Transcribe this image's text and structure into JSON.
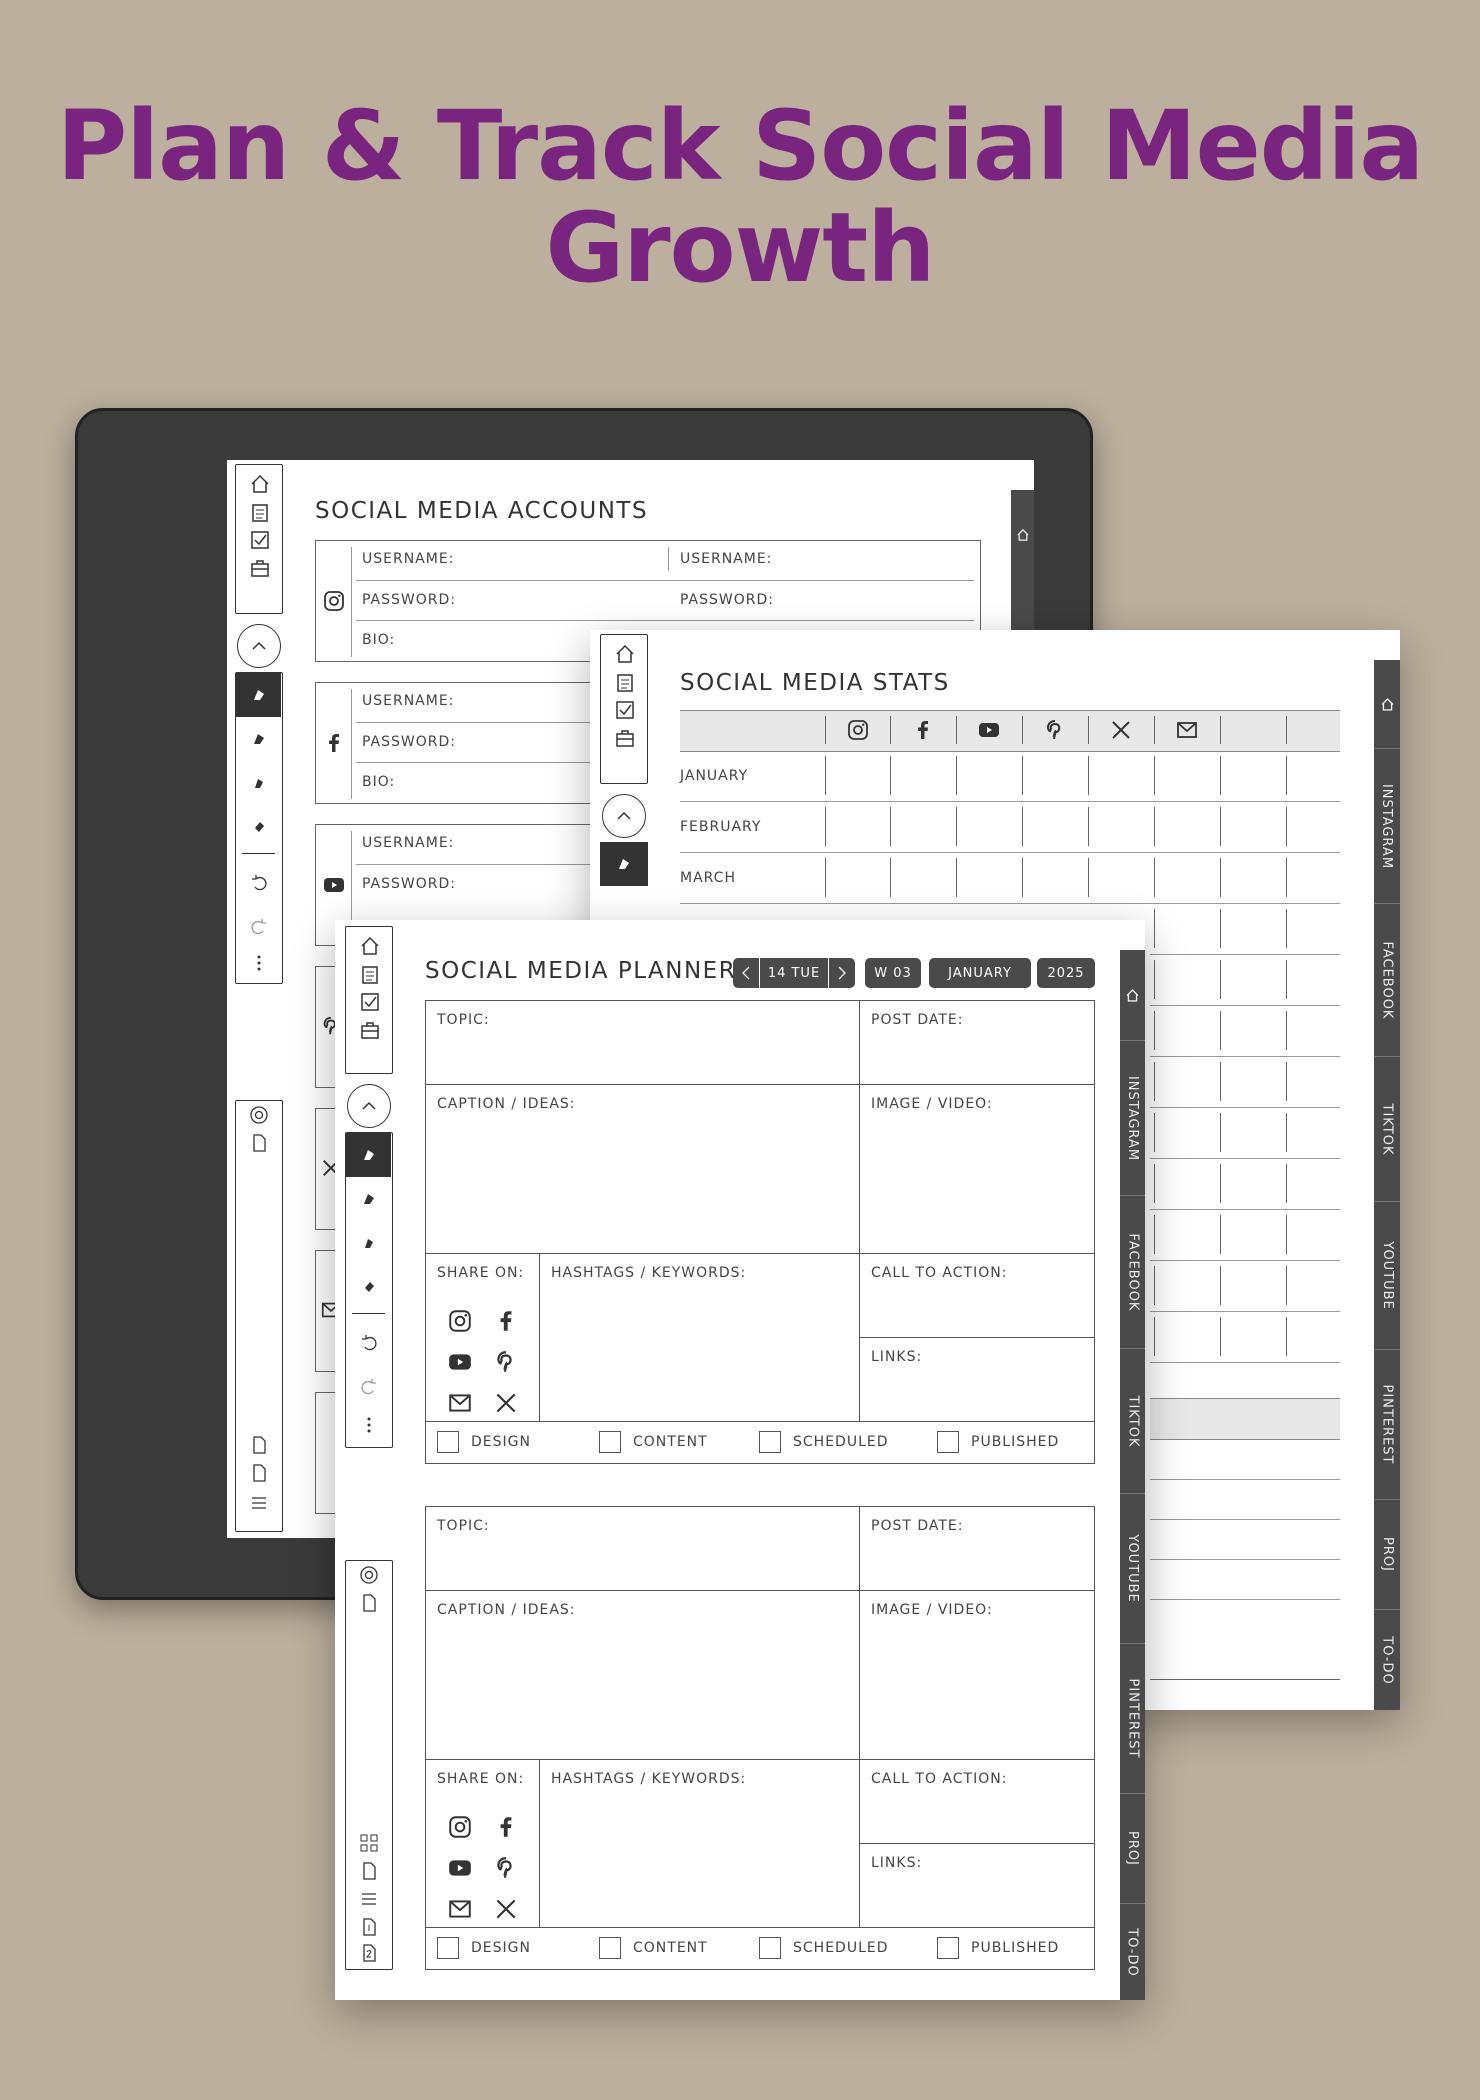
{
  "headline": {
    "line1": "Plan & Track Social Media",
    "line2": "Growth"
  },
  "colors": {
    "headline": "#79247f",
    "background": "#bcaf9d",
    "tabs": "#4a4a4a"
  },
  "accounts_page": {
    "title": "SOCIAL MEDIA ACCOUNTS",
    "username": "USERNAME:",
    "password": "PASSWORD:",
    "bio": "BIO:",
    "platform_icons": [
      "instagram-icon",
      "facebook-icon",
      "youtube-icon",
      "pinterest-icon",
      "x-icon",
      "mail-icon"
    ]
  },
  "stats_page": {
    "title": "SOCIAL MEDIA STATS",
    "column_icons": [
      "instagram-icon",
      "facebook-icon",
      "youtube-icon",
      "pinterest-icon",
      "x-icon",
      "mail-icon"
    ],
    "months": [
      "JANUARY",
      "FEBRUARY",
      "MARCH"
    ],
    "tabs": [
      "INSTAGRAM",
      "FACEBOOK",
      "TIKTOK",
      "YOUTUBE",
      "PINTEREST",
      "PROJ",
      "TO-DO"
    ]
  },
  "planner_page": {
    "title": "SOCIAL MEDIA PLANNER",
    "nav": {
      "day": "14 TUE",
      "week": "W 03",
      "month": "JANUARY",
      "year": "2025"
    },
    "fields": {
      "topic": "TOPIC:",
      "post_date": "POST DATE:",
      "caption": "CAPTION / IDEAS:",
      "image": "IMAGE / VIDEO:",
      "share": "SHARE ON:",
      "hashtags": "HASHTAGS / KEYWORDS:",
      "cta": "CALL TO ACTION:",
      "links": "LINKS:"
    },
    "checkboxes": {
      "design": "DESIGN",
      "content": "CONTENT",
      "scheduled": "SCHEDULED",
      "published": "PUBLISHED"
    },
    "tabs": [
      "INSTAGRAM",
      "FACEBOOK",
      "TIKTOK",
      "YOUTUBE",
      "PINTEREST",
      "PROJ",
      "TO-DO"
    ]
  }
}
